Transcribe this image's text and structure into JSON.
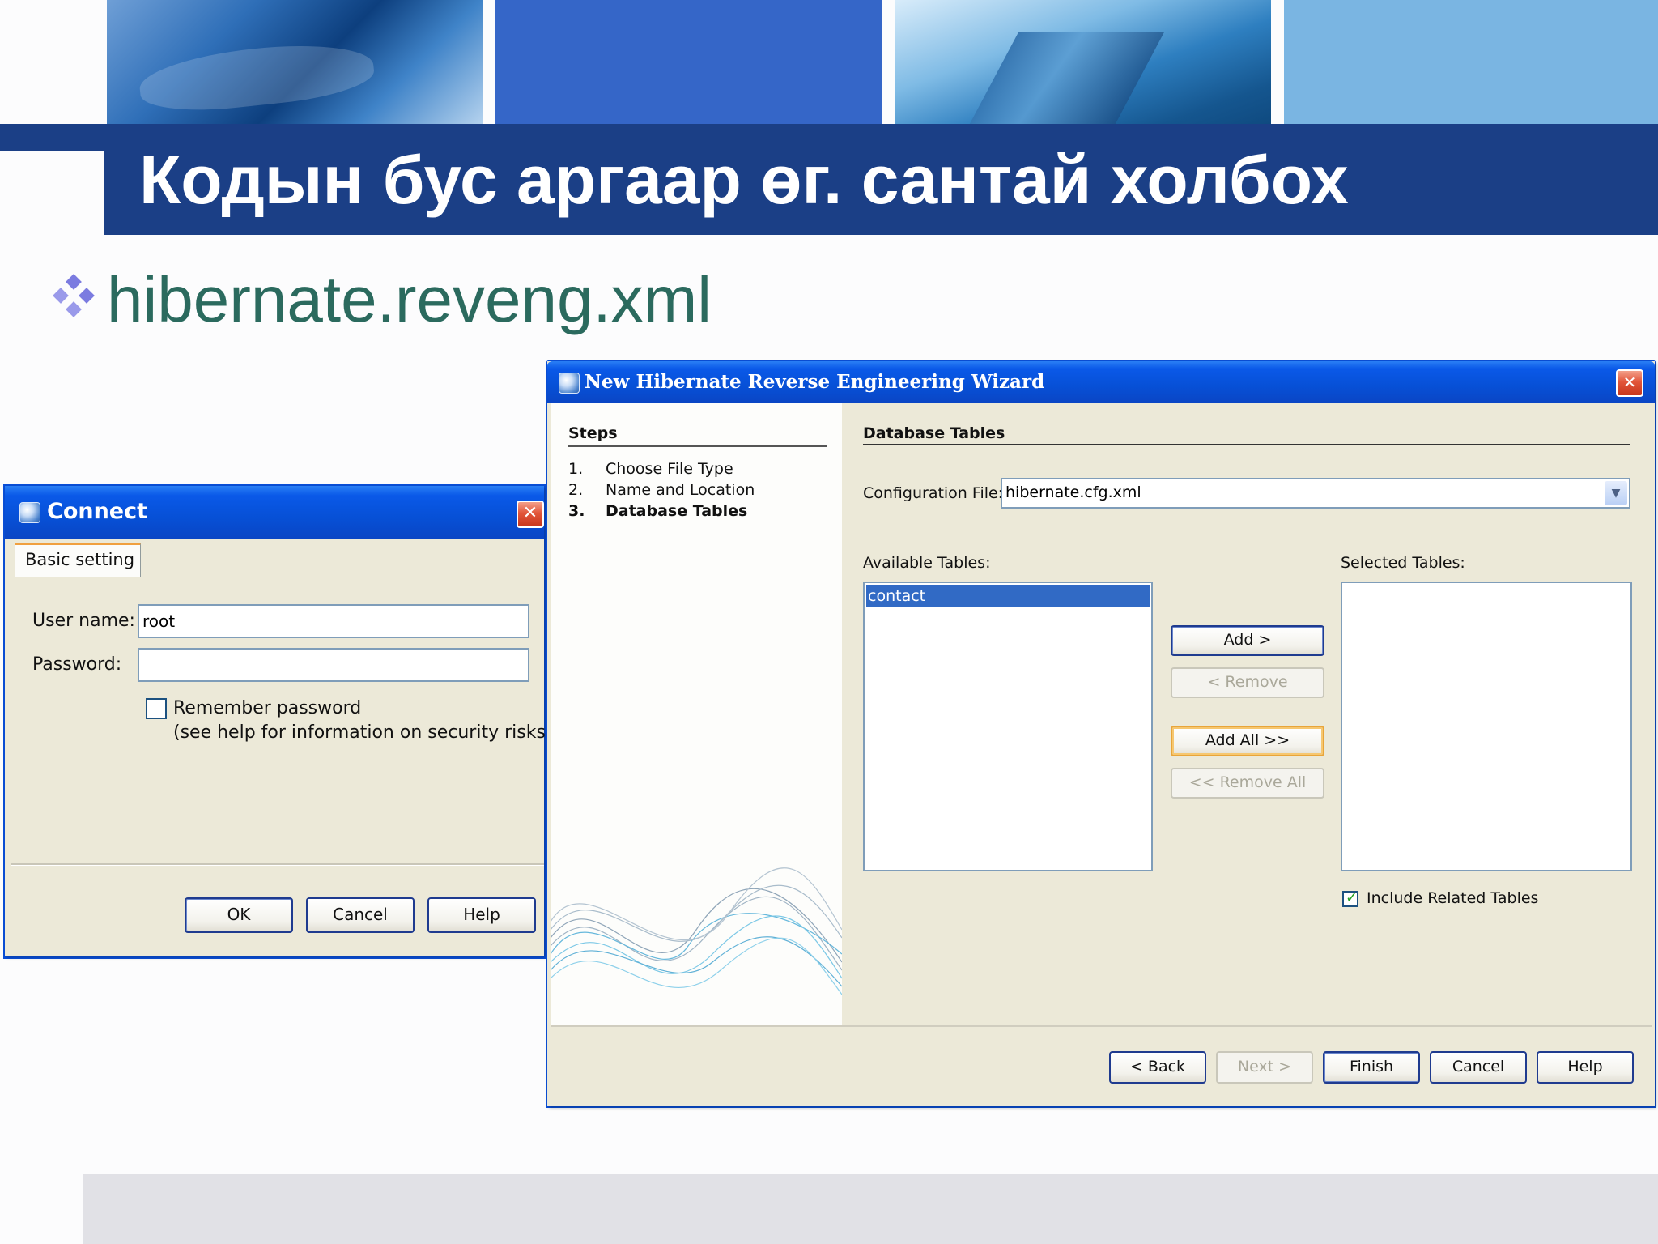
{
  "slide": {
    "title": "Кодын бус аргаар өг. сантай холбох",
    "bullet": "hibernate.reveng.xml"
  },
  "colors": {
    "title_band": "#1b3f86",
    "bullet_text": "#2b6a5e",
    "bullet_icon": "#7b7be0",
    "xp_title_blue": "#0a59e8",
    "selection": "#316ac5"
  },
  "connect_dialog": {
    "title": "Connect",
    "tab": "Basic setting",
    "username_label": "User name:",
    "username_value": "root",
    "password_label": "Password:",
    "password_value": "",
    "remember_label": "Remember password",
    "remember_checked": false,
    "remember_note": "(see help for information on security risks)",
    "ok": "OK",
    "cancel": "Cancel",
    "help": "Help"
  },
  "wizard": {
    "title": "New Hibernate Reverse Engineering Wizard",
    "steps_heading": "Steps",
    "steps": [
      {
        "num": "1.",
        "label": "Choose File Type",
        "current": false
      },
      {
        "num": "2.",
        "label": "Name and Location",
        "current": false
      },
      {
        "num": "3.",
        "label": "Database Tables",
        "current": true
      }
    ],
    "panel_heading": "Database Tables",
    "config_label": "Configuration File:",
    "config_value": "hibernate.cfg.xml",
    "available_label": "Available Tables:",
    "available_items": [
      "contact"
    ],
    "selected_label": "Selected Tables:",
    "selected_items": [],
    "add": "Add >",
    "remove": "< Remove",
    "add_all": "Add All >>",
    "remove_all": "<< Remove All",
    "include_related": "Include Related Tables",
    "include_related_checked": true,
    "back": "< Back",
    "next": "Next >",
    "finish": "Finish",
    "cancel": "Cancel",
    "help": "Help"
  }
}
